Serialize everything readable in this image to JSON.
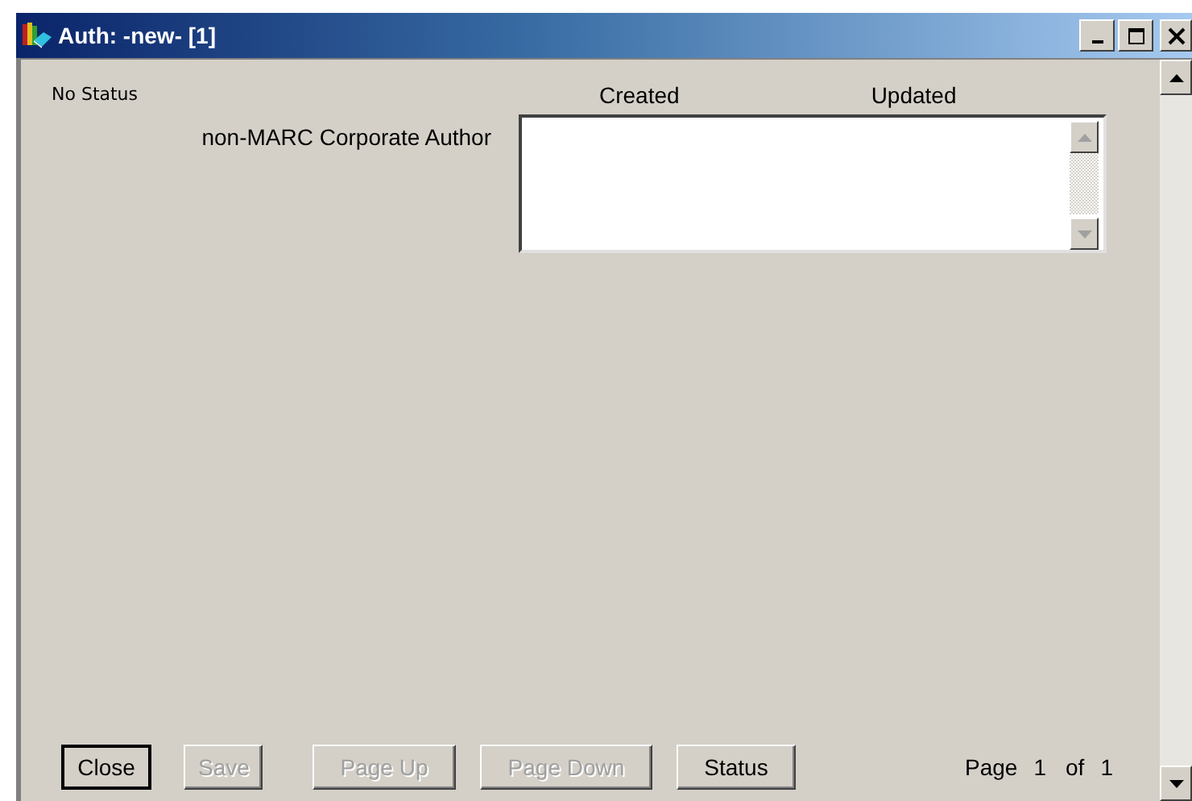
{
  "window": {
    "title": "Auth: -new- [1]"
  },
  "status": "No Status",
  "columns": [
    "Created",
    "Updated"
  ],
  "fields": [
    {
      "label": "non-MARC Corporate Author"
    }
  ],
  "buttons": [
    {
      "label": "Close",
      "disabled": false,
      "default": true
    },
    {
      "label": "Save",
      "disabled": true,
      "default": false
    },
    {
      "label": "Page Up",
      "disabled": true,
      "default": false
    },
    {
      "label": "Page Down",
      "disabled": true,
      "default": false
    },
    {
      "label": "Status",
      "disabled": false,
      "default": false
    }
  ],
  "pager": {
    "label": "Page",
    "page": "1",
    "of": "of",
    "total": "1"
  }
}
